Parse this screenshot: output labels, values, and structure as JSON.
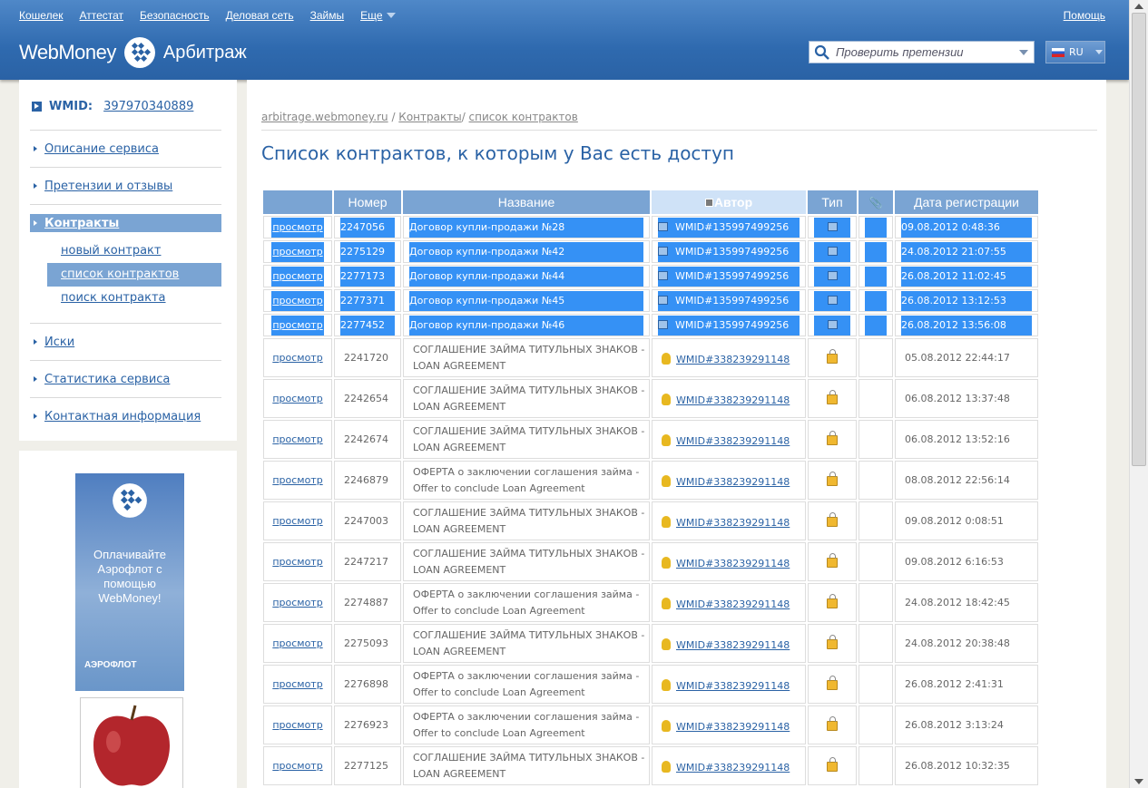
{
  "topnav": [
    "Кошелек",
    "Аттестат",
    "Безопасность",
    "Деловая сеть",
    "Займы",
    "Еще"
  ],
  "help": "Помощь",
  "logo": {
    "wm": "WebMoney",
    "arb": "Арбитраж"
  },
  "search_placeholder": "Проверить претензии",
  "lang": "RU",
  "wmid_label": "WMID:",
  "wmid": "397970340889",
  "menu": [
    "Описание сервиса",
    "Претензии и отзывы",
    "Контракты",
    "новый контракт",
    "список контрактов",
    "поиск контракта",
    "Иски",
    "Статистика сервиса",
    "Контактная информация"
  ],
  "ad": {
    "text": "Оплачивайте Аэрофлот с помощью WebMoney!",
    "brand": "АЭРОФЛОТ"
  },
  "crumb": [
    "arbitrage.webmoney.ru",
    "Контракты",
    "список контрактов"
  ],
  "title": "Список контрактов, к которым у Вас есть доступ",
  "cols": [
    "",
    "Номер",
    "Название",
    "Автор",
    "Тип",
    "",
    "Дата регистрации"
  ],
  "rows": [
    [
      "просмотр",
      "2247056",
      "Договор купли-продажи №28",
      "WMID#135997499256",
      "09.08.2012 0:48:36"
    ],
    [
      "просмотр",
      "2275129",
      "Договор купли-продажи №42",
      "WMID#135997499256",
      "24.08.2012 21:07:55"
    ],
    [
      "просмотр",
      "2277173",
      "Договор купли-продажи №44",
      "WMID#135997499256",
      "26.08.2012 11:02:45"
    ],
    [
      "просмотр",
      "2277371",
      "Договор купли-продажи №45",
      "WMID#135997499256",
      "26.08.2012 13:12:53"
    ],
    [
      "просмотр",
      "2277452",
      "Договор купли-продажи №46",
      "WMID#135997499256",
      "26.08.2012 13:56:08"
    ],
    [
      "просмотр",
      "2241720",
      "СОГЛАШЕНИЕ ЗАЙМА ТИТУЛЬНЫХ ЗНАКОВ - LOAN AGREEMENT",
      "WMID#338239291148",
      "05.08.2012 22:44:17"
    ],
    [
      "просмотр",
      "2242654",
      "СОГЛАШЕНИЕ ЗАЙМА ТИТУЛЬНЫХ ЗНАКОВ - LOAN AGREEMENT",
      "WMID#338239291148",
      "06.08.2012 13:37:48"
    ],
    [
      "просмотр",
      "2242674",
      "СОГЛАШЕНИЕ ЗАЙМА ТИТУЛЬНЫХ ЗНАКОВ - LOAN AGREEMENT",
      "WMID#338239291148",
      "06.08.2012 13:52:16"
    ],
    [
      "просмотр",
      "2246879",
      "ОФЕРТА о заключении соглашения займа - Offer to conclude Loan Agreement",
      "WMID#338239291148",
      "08.08.2012 22:56:14"
    ],
    [
      "просмотр",
      "2247003",
      "СОГЛАШЕНИЕ ЗАЙМА ТИТУЛЬНЫХ ЗНАКОВ - LOAN AGREEMENT",
      "WMID#338239291148",
      "09.08.2012 0:08:51"
    ],
    [
      "просмотр",
      "2247217",
      "СОГЛАШЕНИЕ ЗАЙМА ТИТУЛЬНЫХ ЗНАКОВ - LOAN AGREEMENT",
      "WMID#338239291148",
      "09.08.2012 6:16:53"
    ],
    [
      "просмотр",
      "2274887",
      "ОФЕРТА о заключении соглашения займа - Offer to conclude Loan Agreement",
      "WMID#338239291148",
      "24.08.2012 18:42:45"
    ],
    [
      "просмотр",
      "2275093",
      "СОГЛАШЕНИЕ ЗАЙМА ТИТУЛЬНЫХ ЗНАКОВ - LOAN AGREEMENT",
      "WMID#338239291148",
      "24.08.2012 20:38:48"
    ],
    [
      "просмотр",
      "2276898",
      "ОФЕРТА о заключении соглашения займа - Offer to conclude Loan Agreement",
      "WMID#338239291148",
      "26.08.2012 2:41:31"
    ],
    [
      "просмотр",
      "2276923",
      "ОФЕРТА о заключении соглашения займа - Offer to conclude Loan Agreement",
      "WMID#338239291148",
      "26.08.2012 3:13:24"
    ],
    [
      "просмотр",
      "2277125",
      "СОГЛАШЕНИЕ ЗАЙМА ТИТУЛЬНЫХ ЗНАКОВ - LOAN AGREEMENT",
      "WMID#338239291148",
      "26.08.2012 10:32:35"
    ]
  ]
}
